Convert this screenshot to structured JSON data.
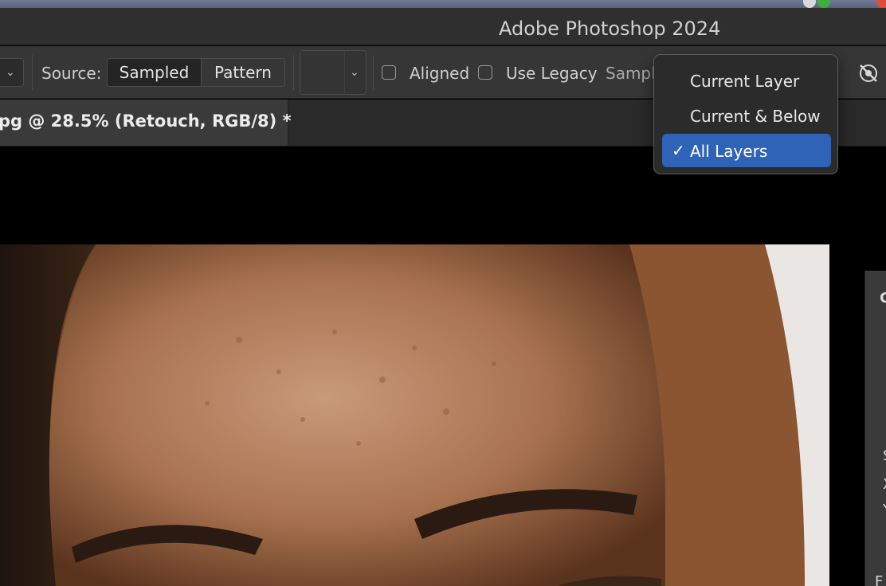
{
  "window": {
    "title": "Adobe Photoshop 2024"
  },
  "options_bar": {
    "source_label": "Source:",
    "source_options": [
      "Sampled",
      "Pattern"
    ],
    "aligned_label": "Aligned",
    "use_legacy_label": "Use Legacy",
    "sample_label_partial": "Sampl"
  },
  "document_tab": {
    "label": "pg @ 28.5% (Retouch, RGB/8) *"
  },
  "sample_dropdown": {
    "items": [
      {
        "label": "Current Layer",
        "selected": false
      },
      {
        "label": "Current & Below",
        "selected": false
      },
      {
        "label": "All Layers",
        "selected": true
      }
    ],
    "check_glyph": "✓",
    "selected_color": "#2f63b8"
  },
  "right_panel": {
    "glyphs": [
      "C",
      "S",
      "X",
      "Y",
      "F"
    ]
  },
  "colors": {
    "options_bar_bg": "#363636",
    "title_bar_bg": "#2f2f2f",
    "canvas_bg": "#000000"
  }
}
